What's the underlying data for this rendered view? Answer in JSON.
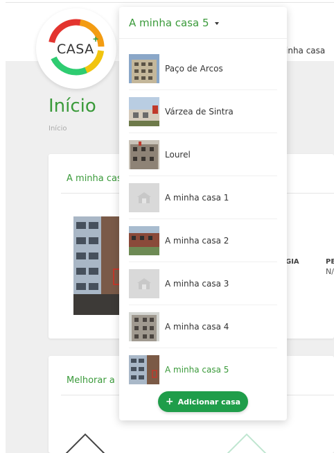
{
  "header": {
    "logo_text": "CASA",
    "logo_plus": "+",
    "nav_link": "inha casa"
  },
  "page": {
    "title": "Início",
    "breadcrumb": "Início"
  },
  "card1": {
    "title": "A minha cas",
    "dot_label": ".",
    "col_gia": "GIA",
    "col_pe": "PE",
    "col_pe_value": "N/"
  },
  "card2": {
    "title": "Melhorar a"
  },
  "dropdown": {
    "selected": "A minha casa 5",
    "items": [
      {
        "label": "Paço de Arcos",
        "thumb": "photo"
      },
      {
        "label": "Várzea de Sintra",
        "thumb": "photo"
      },
      {
        "label": "Lourel",
        "thumb": "photo"
      },
      {
        "label": "A minha casa 1",
        "thumb": "placeholder"
      },
      {
        "label": "A minha casa 2",
        "thumb": "photo"
      },
      {
        "label": "A minha casa 3",
        "thumb": "placeholder"
      },
      {
        "label": "A minha casa 4",
        "thumb": "photo"
      },
      {
        "label": "A minha casa 5",
        "thumb": "photo",
        "active": true
      }
    ],
    "add_button": "Adicionar casa"
  },
  "colors": {
    "accent_green": "#3a9a3a",
    "button_green": "#1f9d4a"
  }
}
